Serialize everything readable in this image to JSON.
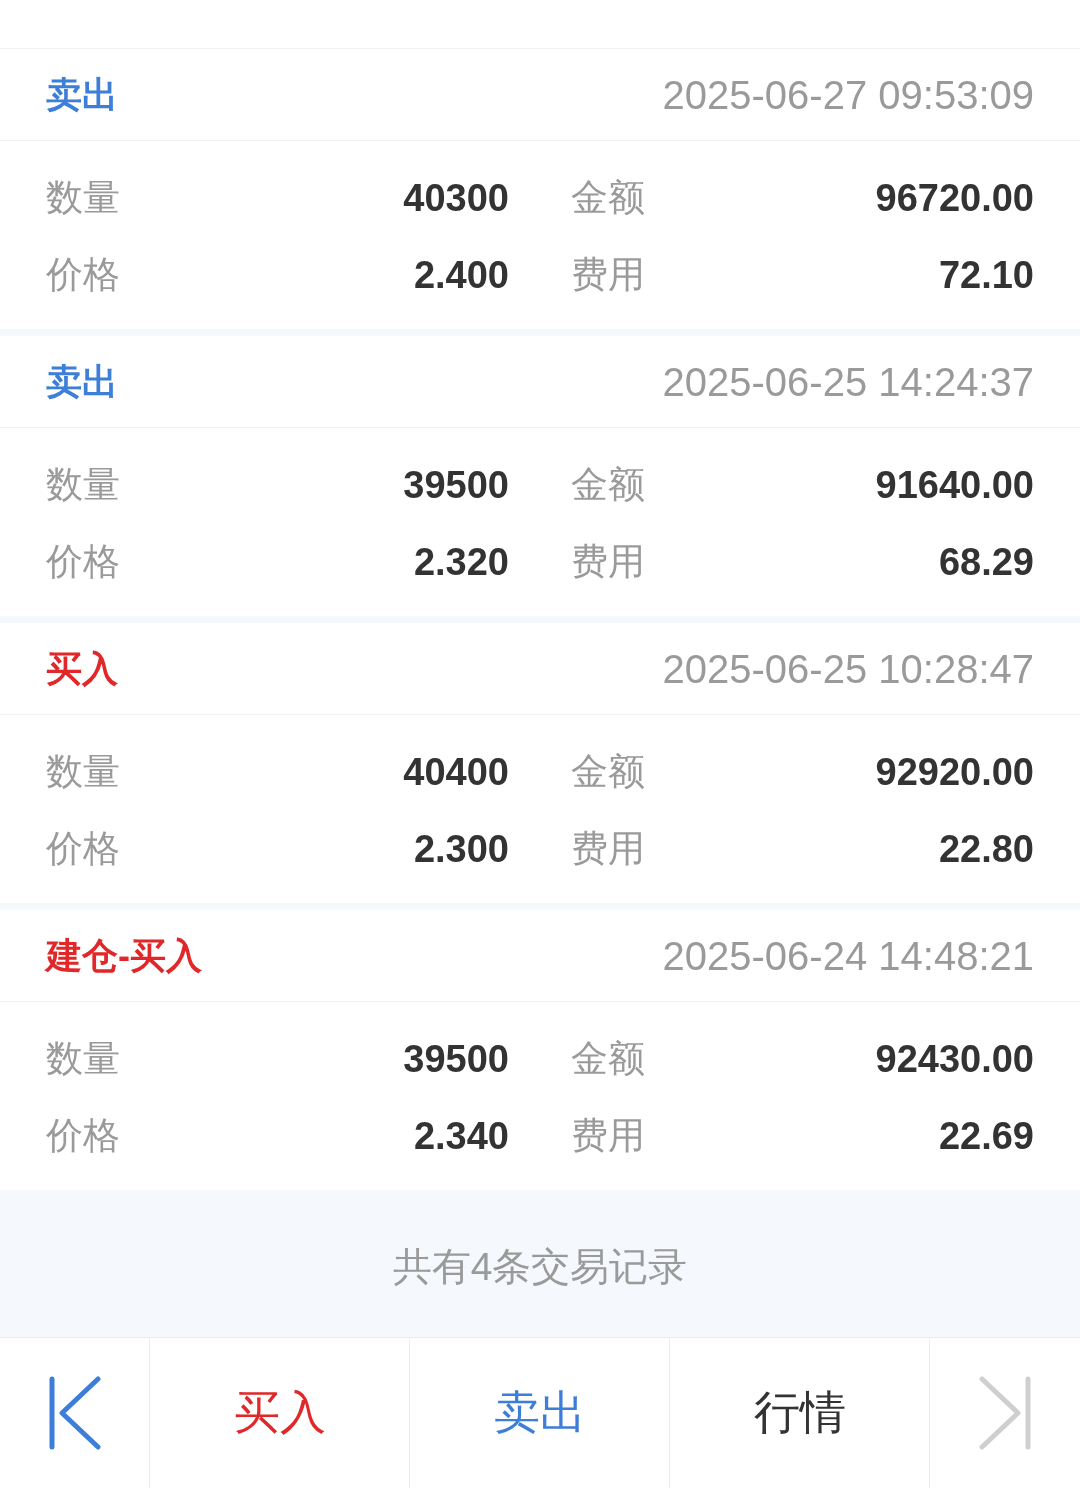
{
  "trades": [
    {
      "type": "卖出",
      "kind": "sell",
      "time": "2025-06-27 09:53:09",
      "fields": [
        {
          "label": "数量",
          "value": "40300"
        },
        {
          "label": "金额",
          "value": "96720.00"
        },
        {
          "label": "价格",
          "value": "2.400"
        },
        {
          "label": "费用",
          "value": "72.10"
        }
      ]
    },
    {
      "type": "卖出",
      "kind": "sell",
      "time": "2025-06-25 14:24:37",
      "fields": [
        {
          "label": "数量",
          "value": "39500"
        },
        {
          "label": "金额",
          "value": "91640.00"
        },
        {
          "label": "价格",
          "value": "2.320"
        },
        {
          "label": "费用",
          "value": "68.29"
        }
      ]
    },
    {
      "type": "买入",
      "kind": "buy",
      "time": "2025-06-25 10:28:47",
      "fields": [
        {
          "label": "数量",
          "value": "40400"
        },
        {
          "label": "金额",
          "value": "92920.00"
        },
        {
          "label": "价格",
          "value": "2.300"
        },
        {
          "label": "费用",
          "value": "22.80"
        }
      ]
    },
    {
      "type": "建仓-买入",
      "kind": "buy",
      "time": "2025-06-24 14:48:21",
      "fields": [
        {
          "label": "数量",
          "value": "39500"
        },
        {
          "label": "金额",
          "value": "92430.00"
        },
        {
          "label": "价格",
          "value": "2.340"
        },
        {
          "label": "费用",
          "value": "22.69"
        }
      ]
    }
  ],
  "summary": "共有4条交易记录",
  "toolbar": [
    {
      "kind": "first",
      "disabled": false
    },
    {
      "kind": "buy",
      "label": "买入"
    },
    {
      "kind": "sell",
      "label": "卖出"
    },
    {
      "kind": "plain",
      "label": "行情"
    },
    {
      "kind": "last",
      "disabled": true
    }
  ]
}
